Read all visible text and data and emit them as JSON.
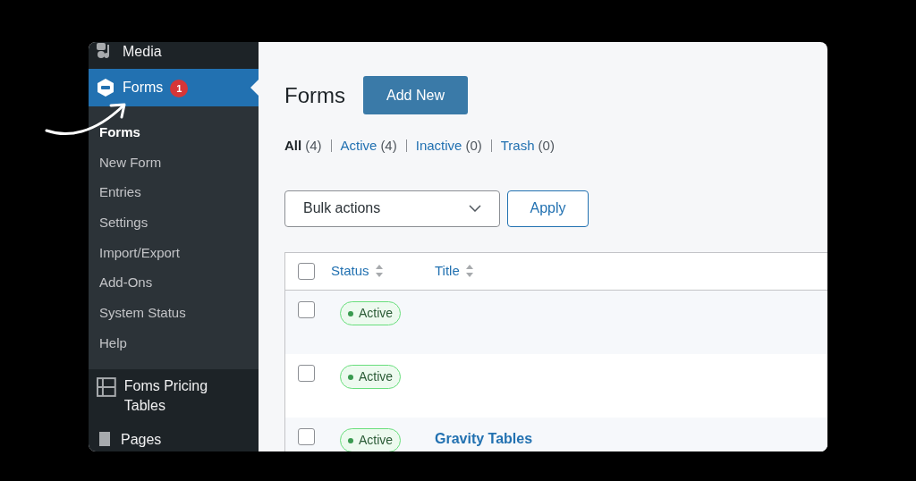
{
  "sidebar": {
    "items": [
      {
        "label": "Media",
        "kind": "media",
        "selected": false
      },
      {
        "label": "Forms",
        "kind": "forms",
        "selected": true,
        "badge": "1",
        "children": [
          {
            "label": "Forms",
            "selected": true
          },
          {
            "label": "New Form",
            "selected": false
          },
          {
            "label": "Entries",
            "selected": false
          },
          {
            "label": "Settings",
            "selected": false
          },
          {
            "label": "Import/Export",
            "selected": false
          },
          {
            "label": "Add-Ons",
            "selected": false
          },
          {
            "label": "System Status",
            "selected": false
          },
          {
            "label": "Help",
            "selected": false
          }
        ]
      },
      {
        "label": "Foms Pricing Tables",
        "kind": "table",
        "selected": false
      },
      {
        "label": "Pages",
        "kind": "pages",
        "selected": false
      }
    ]
  },
  "page": {
    "title": "Forms",
    "add_button": "Add New",
    "filters": [
      {
        "label": "All",
        "count": "(4)",
        "selected": true
      },
      {
        "label": "Active",
        "count": "(4)",
        "selected": false
      },
      {
        "label": "Inactive",
        "count": "(0)",
        "selected": false
      },
      {
        "label": "Trash",
        "count": "(0)",
        "selected": false
      }
    ],
    "bulk_select": "Bulk actions",
    "apply_button": "Apply"
  },
  "table": {
    "select_all_checked": false,
    "columns": [
      "Status",
      "Title"
    ],
    "rows": [
      {
        "checked": false,
        "status": "Active",
        "title": ""
      },
      {
        "checked": false,
        "status": "Active",
        "title": ""
      },
      {
        "checked": false,
        "status": "Active",
        "title": "Gravity Tables"
      }
    ]
  }
}
